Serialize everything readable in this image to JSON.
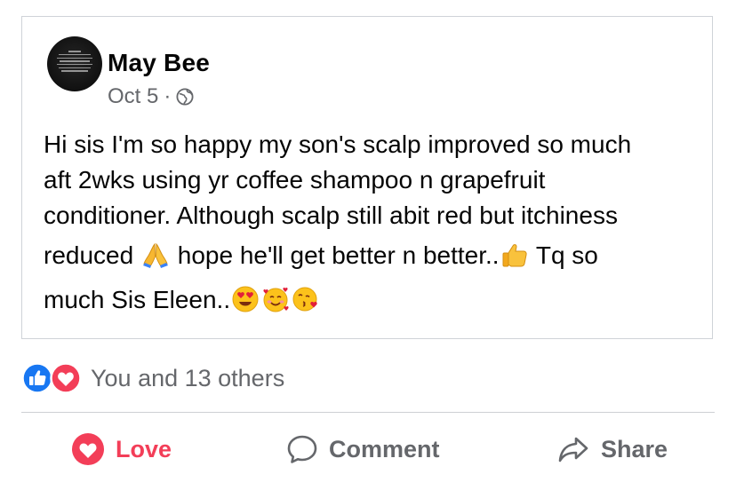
{
  "post": {
    "author": "May Bee",
    "date": "Oct 5",
    "separator": "·",
    "privacy_icon": "globe-icon",
    "lines": [
      "Hi sis I'm so happy my son's scalp improved so much",
      "aft 2wks using yr coffee shampoo n grapefruit",
      "conditioner. Although scalp still abit red but itchiness",
      "reduced ",
      " hope he'll get better n better..",
      " Tq so",
      "much Sis Eleen.."
    ],
    "emojis": [
      "folded-hands-emoji",
      "thumbs-up-emoji",
      "heart-eyes-emoji",
      "smiling-hearts-emoji",
      "kissing-heart-emoji"
    ]
  },
  "reactions": {
    "icons": [
      "like-icon",
      "love-icon"
    ],
    "summary": "You and 13 others"
  },
  "actions": {
    "love_label": "Love",
    "comment_label": "Comment",
    "share_label": "Share"
  },
  "colors": {
    "love": "#f33e58",
    "like": "#1877f2",
    "secondary_text": "#65676b",
    "border": "#cfd3d8"
  }
}
